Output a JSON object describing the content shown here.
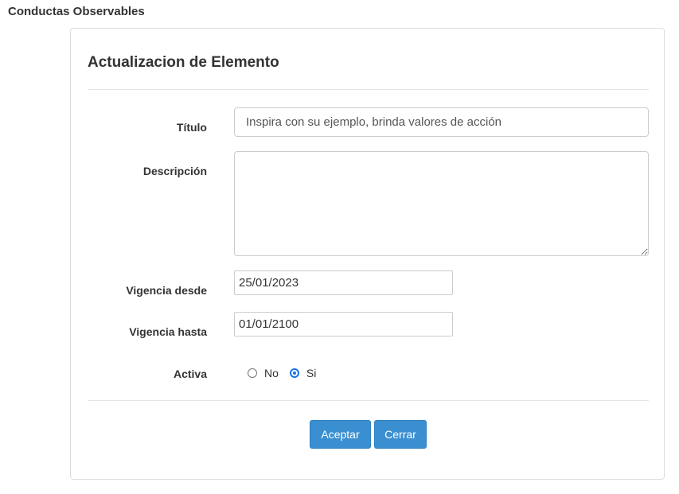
{
  "page": {
    "heading": "Conductas Observables"
  },
  "dialog": {
    "title": "Actualizacion de Elemento",
    "fields": {
      "titulo": {
        "label": "Título",
        "value": "Inspira con su ejemplo, brinda valores de acción"
      },
      "descripcion": {
        "label": "Descripción",
        "value": ""
      },
      "vigencia_desde": {
        "label": "Vigencia desde",
        "value": "25/01/2023"
      },
      "vigencia_hasta": {
        "label": "Vigencia hasta",
        "value": "01/01/2100"
      },
      "activa": {
        "label": "Activa",
        "options": [
          "No",
          "Si"
        ],
        "selected": "Si"
      }
    },
    "buttons": {
      "accept": "Aceptar",
      "close": "Cerrar"
    }
  },
  "colors": {
    "button_bg": "#3a8fd0",
    "radio_accent": "#1a73e8"
  }
}
